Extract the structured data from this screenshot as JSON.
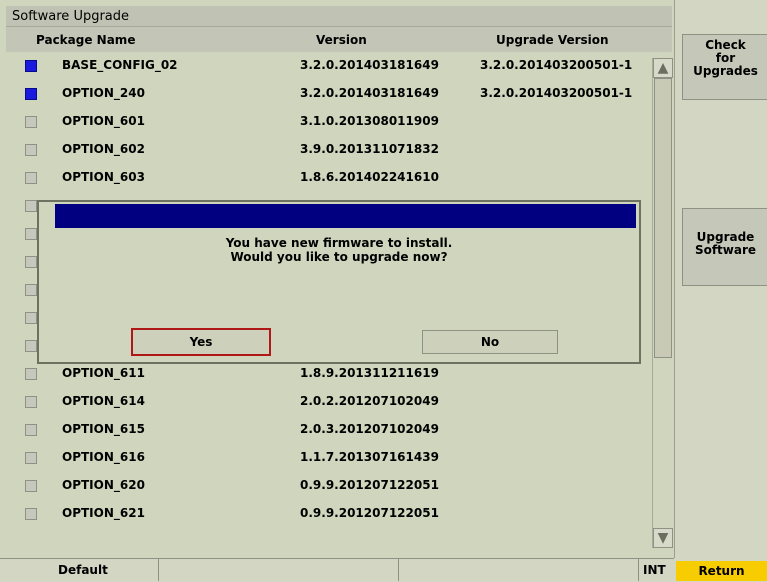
{
  "window": {
    "title": "Software Upgrade"
  },
  "columns": {
    "name": "Package Name",
    "version": "Version",
    "upgrade": "Upgrade Version"
  },
  "rows": [
    {
      "name": "BASE_CONFIG_02",
      "version": "3.2.0.201403181649",
      "upgrade": "3.2.0.201403200501-1",
      "checked": true
    },
    {
      "name": "OPTION_240",
      "version": "3.2.0.201403181649",
      "upgrade": "3.2.0.201403200501-1",
      "checked": true
    },
    {
      "name": "OPTION_601",
      "version": "3.1.0.201308011909",
      "upgrade": "",
      "checked": false
    },
    {
      "name": "OPTION_602",
      "version": "3.9.0.201311071832",
      "upgrade": "",
      "checked": false
    },
    {
      "name": "OPTION_603",
      "version": "1.8.6.201402241610",
      "upgrade": "",
      "checked": false
    },
    {
      "name": "",
      "version": "",
      "upgrade": "",
      "checked": false
    },
    {
      "name": "",
      "version": "",
      "upgrade": "",
      "checked": false
    },
    {
      "name": "",
      "version": "",
      "upgrade": "",
      "checked": false
    },
    {
      "name": "",
      "version": "",
      "upgrade": "",
      "checked": false
    },
    {
      "name": "",
      "version": "",
      "upgrade": "",
      "checked": false
    },
    {
      "name": "",
      "version": "",
      "upgrade": "",
      "checked": false
    },
    {
      "name": "OPTION_611",
      "version": "1.8.9.201311211619",
      "upgrade": "",
      "checked": false
    },
    {
      "name": "OPTION_614",
      "version": "2.0.2.201207102049",
      "upgrade": "",
      "checked": false
    },
    {
      "name": "OPTION_615",
      "version": "2.0.3.201207102049",
      "upgrade": "",
      "checked": false
    },
    {
      "name": "OPTION_616",
      "version": "1.1.7.201307161439",
      "upgrade": "",
      "checked": false
    },
    {
      "name": "OPTION_620",
      "version": "0.9.9.201207122051",
      "upgrade": "",
      "checked": false
    },
    {
      "name": "OPTION_621",
      "version": "0.9.9.201207122051",
      "upgrade": "",
      "checked": false
    }
  ],
  "softkeys": {
    "check": "Check\nfor\nUpgrades",
    "upgrade": "Upgrade\nSoftware",
    "return": "Return"
  },
  "status": {
    "default": "Default",
    "int": "INT"
  },
  "dialog": {
    "message": "You have new firmware to install.\nWould you like to upgrade now?",
    "yes": "Yes",
    "no": "No"
  },
  "scrollbar": {
    "up": "▲",
    "down": "▼"
  }
}
